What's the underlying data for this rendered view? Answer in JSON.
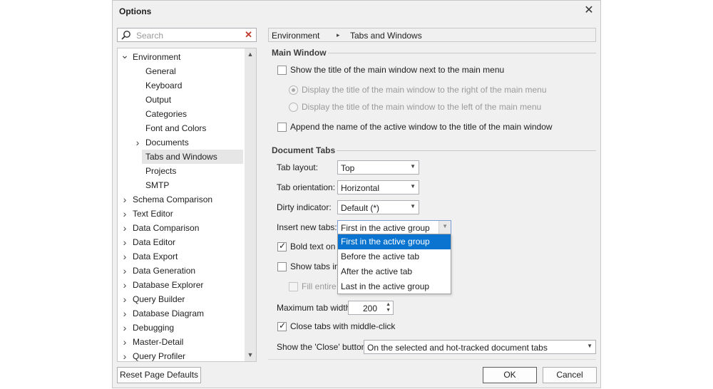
{
  "window": {
    "title": "Options",
    "close_glyph": "✕"
  },
  "search": {
    "placeholder": "Search",
    "clear_glyph": "✕"
  },
  "tree": [
    {
      "label": "Environment",
      "level": 0,
      "expanded": true
    },
    {
      "label": "General",
      "level": 1
    },
    {
      "label": "Keyboard",
      "level": 1
    },
    {
      "label": "Output",
      "level": 1
    },
    {
      "label": "Categories",
      "level": 1
    },
    {
      "label": "Font and Colors",
      "level": 1
    },
    {
      "label": "Documents",
      "level": 1,
      "collapsed": true
    },
    {
      "label": "Tabs and Windows",
      "level": 1,
      "selected": true
    },
    {
      "label": "Projects",
      "level": 1
    },
    {
      "label": "SMTP",
      "level": 1
    },
    {
      "label": "Schema Comparison",
      "level": 0,
      "collapsed": true
    },
    {
      "label": "Text Editor",
      "level": 0,
      "collapsed": true
    },
    {
      "label": "Data Comparison",
      "level": 0,
      "collapsed": true
    },
    {
      "label": "Data Editor",
      "level": 0,
      "collapsed": true
    },
    {
      "label": "Data Export",
      "level": 0,
      "collapsed": true
    },
    {
      "label": "Data Generation",
      "level": 0,
      "collapsed": true
    },
    {
      "label": "Database Explorer",
      "level": 0,
      "collapsed": true
    },
    {
      "label": "Query Builder",
      "level": 0,
      "collapsed": true
    },
    {
      "label": "Database Diagram",
      "level": 0,
      "collapsed": true
    },
    {
      "label": "Debugging",
      "level": 0,
      "collapsed": true
    },
    {
      "label": "Master-Detail",
      "level": 0,
      "collapsed": true
    },
    {
      "label": "Query Profiler",
      "level": 0,
      "collapsed": true
    }
  ],
  "breadcrumb": {
    "root": "Environment",
    "sep": "▸",
    "current": "Tabs and Windows"
  },
  "main_window": {
    "heading": "Main Window",
    "show_title": {
      "label": "Show the title of the main window next to the main menu",
      "checked": false
    },
    "radio_right": {
      "label": "Display the title of the main window to the right of the main menu",
      "selected": true
    },
    "radio_left": {
      "label": "Display the title of the main window to the left of the main menu",
      "selected": false
    },
    "append_name": {
      "label": "Append the name of the active window to the title of the main window",
      "checked": false
    }
  },
  "document_tabs": {
    "heading": "Document Tabs",
    "tab_layout": {
      "label": "Tab layout:",
      "value": "Top"
    },
    "tab_orientation": {
      "label": "Tab orientation:",
      "value": "Horizontal"
    },
    "dirty_indicator": {
      "label": "Dirty indicator:",
      "value": "Default (*)"
    },
    "insert_new_tabs": {
      "label": "Insert new tabs:",
      "value": "First in the active group",
      "options": [
        "First in the active group",
        "Before the active tab",
        "After the active tab",
        "Last in the active group"
      ],
      "highlighted": "First in the active group"
    },
    "bold_text": {
      "label": "Bold text on s",
      "checked": true
    },
    "show_tabs": {
      "label": "Show tabs in",
      "checked": false
    },
    "fill_entire": {
      "label": "Fill entire c",
      "checked": false
    },
    "max_tab_width": {
      "label": "Maximum tab width:",
      "value": "200"
    },
    "close_middle_click": {
      "label": "Close tabs with middle-click",
      "checked": true
    },
    "show_close_button": {
      "label": "Show the 'Close' button:",
      "value": "On the selected and hot-tracked document tabs"
    }
  },
  "buttons": {
    "reset": "Reset Page Defaults",
    "ok": "OK",
    "cancel": "Cancel"
  },
  "colors": {
    "dialog_bg": "#f0f0f0",
    "highlight": "#0a74d0",
    "selected_tree": "#e6e6e6"
  }
}
